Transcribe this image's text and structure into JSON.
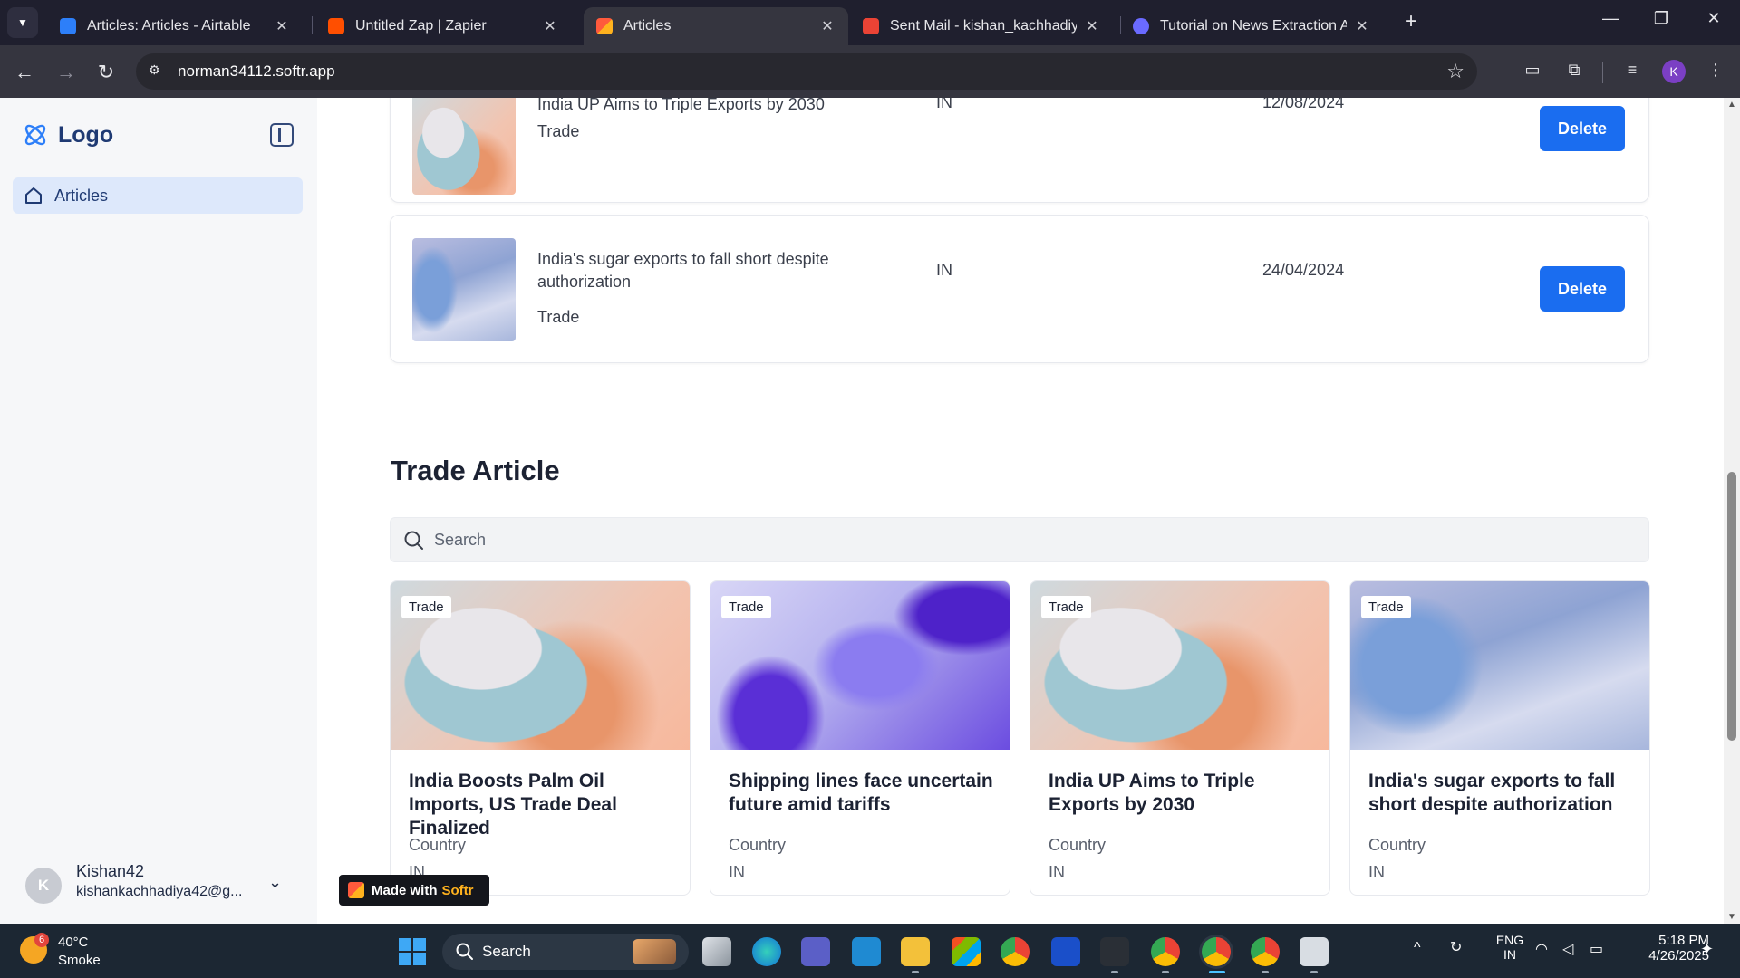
{
  "browser": {
    "tabs": [
      {
        "title": "Articles: Articles - Airtable",
        "favicon_color": "#2d7ff9"
      },
      {
        "title": "Untitled Zap | Zapier",
        "favicon_color": "#ff4f00"
      },
      {
        "title": "Articles",
        "favicon_color": "#ffb21e"
      },
      {
        "title": "Sent Mail - kishan_kachhadiya@",
        "favicon_color": "#ea4335"
      },
      {
        "title": "Tutorial on News Extraction Aut",
        "favicon_color": "#6a6aff"
      }
    ],
    "url": "norman34112.softr.app",
    "profile_initial": "K"
  },
  "sidebar": {
    "logo_text": "Logo",
    "nav": [
      {
        "label": "Articles",
        "icon": "home-icon",
        "active": true
      }
    ],
    "user": {
      "initial": "K",
      "name": "Kishan42",
      "email": "kishankachhadiya42@g..."
    },
    "badge": {
      "prefix": "Made with",
      "brand": "Softr"
    }
  },
  "list_rows": [
    {
      "title": "India UP Aims to Triple Exports by 2030",
      "tag": "Trade",
      "country": "IN",
      "date": "12/08/2024",
      "action": "Delete"
    },
    {
      "title": "India's sugar exports to fall short despite authorization",
      "tag": "Trade",
      "country": "IN",
      "date": "24/04/2024",
      "action": "Delete"
    }
  ],
  "section": {
    "title": "Trade Article",
    "search_placeholder": "Search"
  },
  "cards": [
    {
      "tag": "Trade",
      "title": "India Boosts Palm Oil Imports, US Trade Deal Finalized",
      "country_label": "Country",
      "country": "IN"
    },
    {
      "tag": "Trade",
      "title": "Shipping lines face uncertain future amid tariffs",
      "country_label": "Country",
      "country": "IN"
    },
    {
      "tag": "Trade",
      "title": "India UP Aims to Triple Exports by 2030",
      "country_label": "Country",
      "country": "IN"
    },
    {
      "tag": "Trade",
      "title": "India's sugar exports to fall short despite authorization",
      "country_label": "Country",
      "country": "IN"
    }
  ],
  "taskbar": {
    "weather": {
      "badge": "6",
      "temp": "40°C",
      "condition": "Smoke"
    },
    "search_label": "Search",
    "language": {
      "line1": "ENG",
      "line2": "IN"
    },
    "clock": {
      "time": "5:18 PM",
      "date": "4/26/2025"
    }
  },
  "colors": {
    "accent": "#1a6df0",
    "logo": "#1f3a73",
    "nav_active_bg": "#dde8fb"
  }
}
